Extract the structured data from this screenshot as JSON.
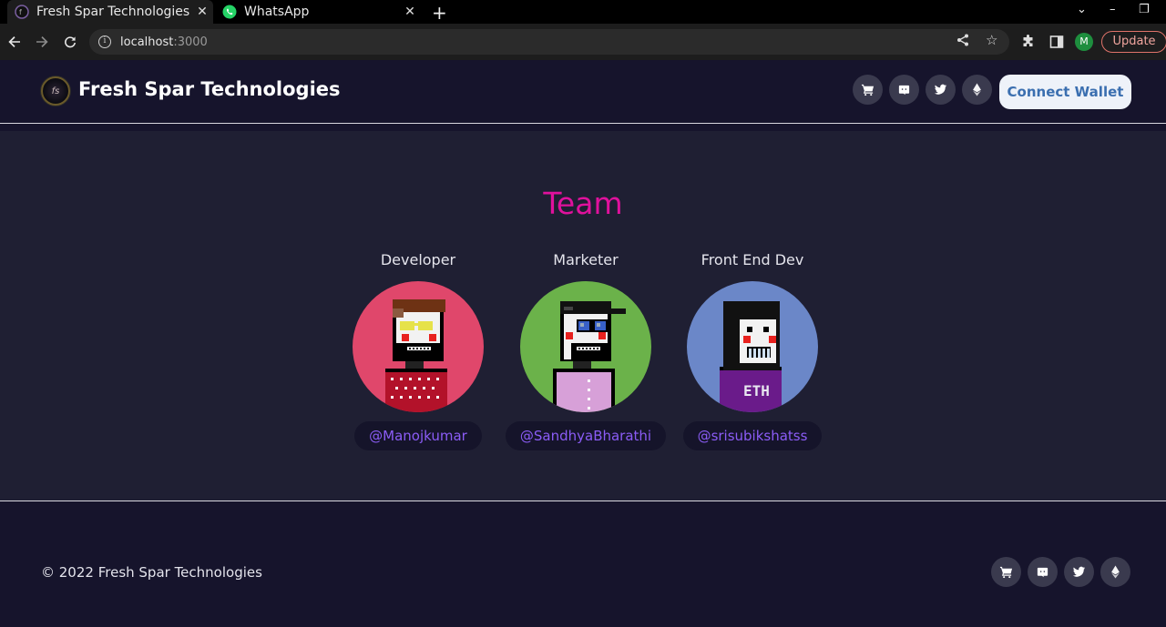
{
  "browser": {
    "tabs": [
      {
        "title": "Fresh Spar Technologies",
        "active": true
      },
      {
        "title": "WhatsApp",
        "active": false
      }
    ],
    "url_host": "localhost",
    "url_port": ":3000",
    "profile_initial": "M",
    "update_label": "Update"
  },
  "header": {
    "brand": "Fresh Spar Technologies",
    "logo_text": "fs",
    "icons": [
      "cart-icon",
      "discord-icon",
      "twitter-icon",
      "ethereum-icon"
    ],
    "connect_label": "Connect Wallet"
  },
  "team": {
    "title": "Team",
    "members": [
      {
        "role": "Developer",
        "handle": "@Manojkumar",
        "bg": "#e0476b"
      },
      {
        "role": "Marketer",
        "handle": "@SandhyaBharathi",
        "bg": "#6bb24a"
      },
      {
        "role": "Front End Dev",
        "handle": "@srisubikshatss",
        "bg": "#6b87c8"
      }
    ]
  },
  "footer": {
    "copyright": "© 2022 Fresh Spar Technologies",
    "icons": [
      "cart-icon",
      "discord-icon",
      "twitter-icon",
      "ethereum-icon"
    ]
  },
  "colors": {
    "accent_pink": "#e0119d",
    "handle_purple": "#8b5cf6",
    "page_bg": "#1f1f33",
    "header_bg": "#16142c"
  }
}
